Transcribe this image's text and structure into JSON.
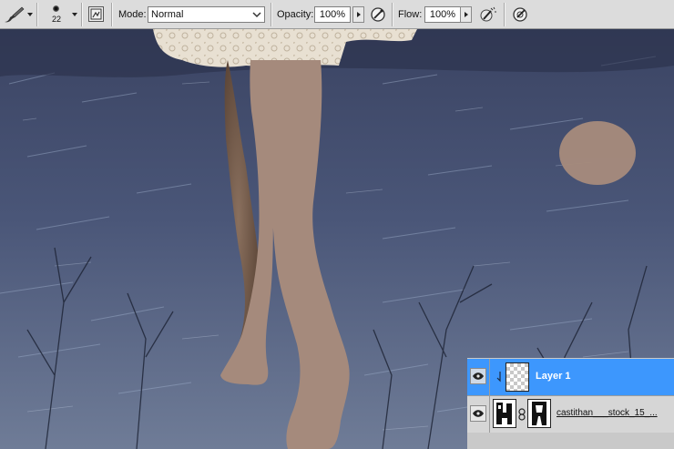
{
  "options_bar": {
    "tool_icon": "brush-tool-icon",
    "brush_size": "22",
    "panel_toggle_icon": "brush-panel-toggle-icon",
    "mode_label": "Mode:",
    "mode_value": "Normal",
    "opacity_label": "Opacity:",
    "opacity_value": "100%",
    "pressure_opacity_icon": "tablet-pressure-opacity-icon",
    "flow_label": "Flow:",
    "flow_value": "100%",
    "airbrush_icon": "airbrush-icon",
    "pressure_size_icon": "tablet-pressure-size-icon"
  },
  "layers": [
    {
      "name": "Layer 1",
      "selected": true,
      "visible": true,
      "thumbnail": "transparent-checker",
      "clipped": true
    },
    {
      "name": "castithan___stock_15_...",
      "selected": false,
      "visible": true,
      "thumbnail": "photo",
      "has_mask": true
    }
  ],
  "colors": {
    "selection": "#3d97fd",
    "paint": "#a58a7c",
    "toolbar": "#dcdcdc"
  }
}
